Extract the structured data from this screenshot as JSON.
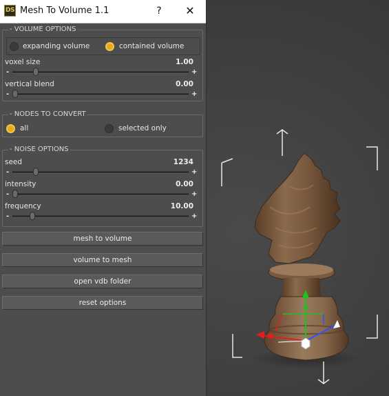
{
  "window": {
    "logo_text": "DS",
    "title": "Mesh To Volume 1.1",
    "help_label": "?",
    "close_label": "✕"
  },
  "volume_options": {
    "title": "- VOLUME OPTIONS",
    "mode_options": [
      {
        "label": "expanding volume",
        "selected": false
      },
      {
        "label": "contained volume",
        "selected": true
      }
    ],
    "sliders": [
      {
        "label": "voxel size",
        "value": "1.00",
        "level": 0.12
      },
      {
        "label": "vertical blend",
        "value": "0.00",
        "level": 0.0
      }
    ]
  },
  "nodes_to_convert": {
    "title": "- NODES TO CONVERT",
    "options": [
      {
        "label": "all",
        "selected": true
      },
      {
        "label": "selected only",
        "selected": false
      }
    ]
  },
  "noise_options": {
    "title": "- NOISE OPTIONS",
    "sliders": [
      {
        "label": "seed",
        "value": "1234",
        "level": 0.12
      },
      {
        "label": "intensity",
        "value": "0.00",
        "level": 0.0
      },
      {
        "label": "frequency",
        "value": "10.00",
        "level": 0.1
      }
    ]
  },
  "slider_minus": "-",
  "slider_plus": "+",
  "buttons": {
    "mesh_to_volume": "mesh to volume",
    "volume_to_mesh": "volume to mesh",
    "open_vdb_folder": "open vdb folder",
    "reset_options": "reset options"
  },
  "viewport": {
    "object": "chess-knight",
    "material_color": "#7a5a40",
    "gizmo_colors": {
      "x": "#e02020",
      "y": "#20c020",
      "z": "#3050ff"
    }
  }
}
